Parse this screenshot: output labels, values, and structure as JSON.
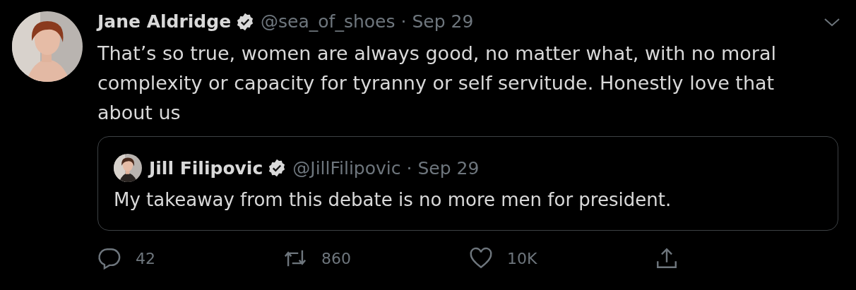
{
  "tweet": {
    "author": {
      "name": "Jane Aldridge",
      "verified": true,
      "handle": "@sea_of_shoes",
      "separator": "·",
      "date": "Sep 29"
    },
    "text": "That’s so true, women are always good, no matter what, with no moral complexity or capacity for tyranny or self servitude. Honestly love that about us",
    "quoted_tweet": {
      "author": {
        "name": "Jill Filipovic",
        "verified": true,
        "handle": "@JillFilipovic",
        "separator": "·",
        "date": "Sep 29"
      },
      "text": "My takeaway from this debate is no more men for president."
    },
    "actions": [
      {
        "kind": "reply",
        "count": "42"
      },
      {
        "kind": "retweet",
        "count": "860"
      },
      {
        "kind": "like",
        "count": "10K"
      },
      {
        "kind": "share"
      }
    ]
  }
}
